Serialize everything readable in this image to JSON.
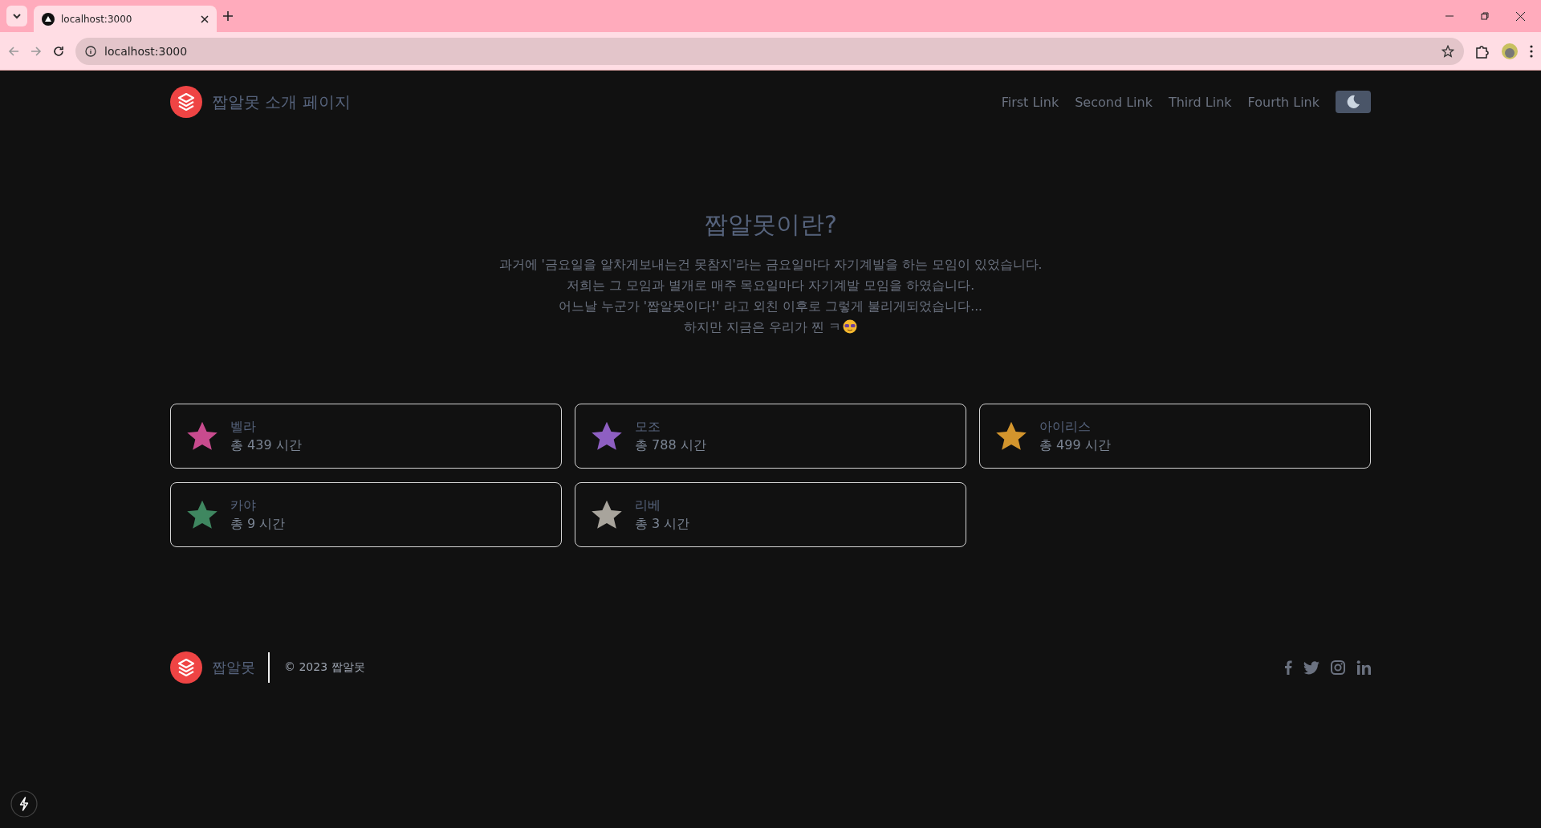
{
  "browser": {
    "tab_title": "localhost:3000",
    "url": "localhost:3000"
  },
  "header": {
    "title": "짭알못 소개 페이지",
    "links": [
      "First Link",
      "Second Link",
      "Third Link",
      "Fourth Link"
    ]
  },
  "hero": {
    "title": "짭알못이란?",
    "lines": [
      "과거에 '금요일을 알차게보내는건 못참지'라는 금요일마다 자기계발을 하는 모임이 있었습니다.",
      "저희는 그 모임과 별개로 매주 목요일마다 자기계발 모임을 하였습니다.",
      "어느날 누군가 '짭알못이다!' 라고 외친 이후로 그렇게 불리게되었습니다...",
      "하지만 지금은 우리가 찐 ㅋ"
    ]
  },
  "members": [
    {
      "name": "벨라",
      "hours": "총 439 시간",
      "color": "#c84b8e"
    },
    {
      "name": "모조",
      "hours": "총 788 시간",
      "color": "#8e5fc2"
    },
    {
      "name": "아이리스",
      "hours": "총 499 시간",
      "color": "#d3952d"
    },
    {
      "name": "카야",
      "hours": "총 9 시간",
      "color": "#3f8760"
    },
    {
      "name": "리베",
      "hours": "총 3 시간",
      "color": "#a8a49c"
    }
  ],
  "footer": {
    "brand": "짭알못",
    "copyright": "© 2023 짭알못"
  }
}
